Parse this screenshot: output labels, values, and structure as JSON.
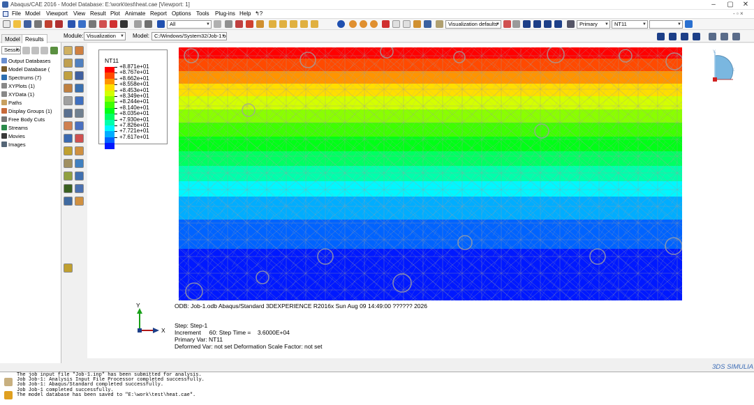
{
  "window": {
    "title": "Abaqus/CAE 2016 - Model Database: E:\\work\\test\\heat.cae [Viewport: 1]",
    "min": "–",
    "max": "▢",
    "close": "✕",
    "restore": "- ▫ ×"
  },
  "menubar": {
    "items": [
      "File",
      "Model",
      "Viewport",
      "View",
      "Result",
      "Plot",
      "Animate",
      "Report",
      "Options",
      "Tools",
      "Plug-ins",
      "Help",
      "↰?"
    ]
  },
  "toolbar": {
    "filter_value": "All",
    "viz_defaults": "Visualization defaults",
    "primary": "Primary",
    "field": "NT11",
    "refresh_icon": "refresh-icon"
  },
  "context": {
    "module_label": "Module:",
    "module_value": "Visualization",
    "model_label": "Model:",
    "model_value": "C:/Windows/System32/Job-1.odb"
  },
  "left_tabs": [
    "Model",
    "Results"
  ],
  "session_value": "Sessio",
  "tree": [
    {
      "label": "Output Databases",
      "color": "#6a8fd0"
    },
    {
      "label": "Model Database (",
      "color": "#7a5c2a"
    },
    {
      "label": "Spectrums (7)",
      "color": "#2d6fb0"
    },
    {
      "label": "XYPlots (1)",
      "color": "#888888"
    },
    {
      "label": "XYData (1)",
      "color": "#888888"
    },
    {
      "label": "Paths",
      "color": "#c8a060"
    },
    {
      "label": "Display Groups (1)",
      "color": "#c86a3a"
    },
    {
      "label": "Free Body Cuts",
      "color": "#777777"
    },
    {
      "label": "Streams",
      "color": "#2a8a4a"
    },
    {
      "label": "Movies",
      "color": "#3a3a3a"
    },
    {
      "label": "Images",
      "color": "#556677"
    }
  ],
  "legend": {
    "title": "NT11",
    "values": [
      "+8.871e+01",
      "+8.767e+01",
      "+8.662e+01",
      "+8.558e+01",
      "+8.453e+01",
      "+8.349e+01",
      "+8.244e+01",
      "+8.140e+01",
      "+8.035e+01",
      "+7.930e+01",
      "+7.826e+01",
      "+7.721e+01",
      "+7.617e+01"
    ],
    "colors": [
      "#ff0000",
      "#ff4a00",
      "#ff9400",
      "#ffde00",
      "#d4ff00",
      "#8aff00",
      "#3fff00",
      "#00ff17",
      "#00ff62",
      "#00ffac",
      "#00f7ff",
      "#00adff",
      "#0063ff",
      "#0019ff"
    ]
  },
  "contour_bands": [
    "#ff0000",
    "#ff4a00",
    "#ff9400",
    "#ffde00",
    "#d4ff00",
    "#8aff00",
    "#3fff00",
    "#00ff17",
    "#00ff62",
    "#00ffac",
    "#00f7ff",
    "#00adff",
    "#0063ff",
    "#0019ff"
  ],
  "viewport_info": {
    "odb_line": "ODB: Job-1.odb    Abaqus/Standard 3DEXPERIENCE R2016x    Sun Aug 09 14:49:00 ?????? 2026",
    "step": "Step: Step-1",
    "increment": "Increment     60: Step Time =    3.6000E+04",
    "primary_var": "Primary Var: NT11",
    "deformed": "Deformed Var: not set   Deformation Scale Factor: not set"
  },
  "triad": {
    "x": "X",
    "y": "Y"
  },
  "messages": [
    "The job input file \"Job-1.inp\" has been submitted for analysis.",
    "Job Job-1: Analysis Input File Processor completed successfully.",
    "Job Job-1: Abaqus/Standard completed successfully.",
    "Job Job-1 completed successfully.",
    "The model database has been saved to \"E:\\work\\test\\heat.cae\"."
  ],
  "brand": "3DS SIMULIA"
}
